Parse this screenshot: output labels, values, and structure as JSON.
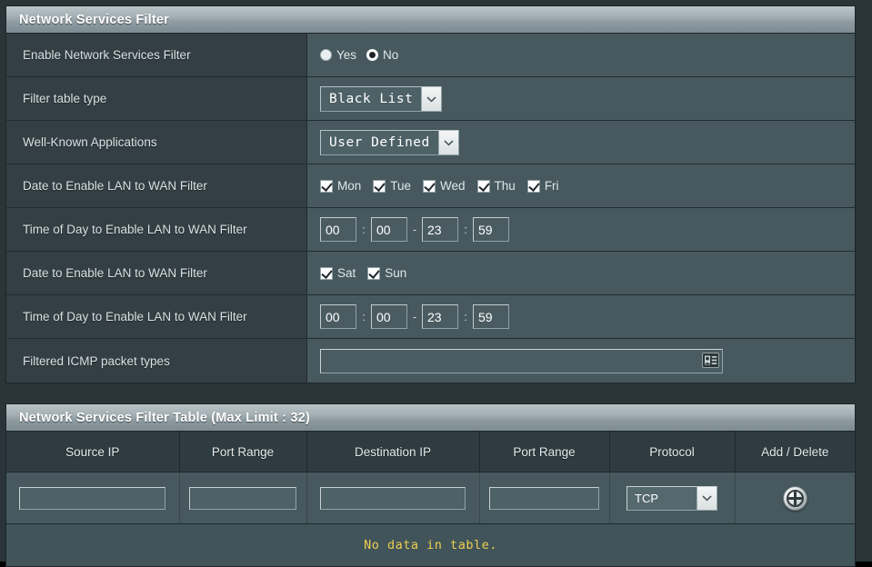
{
  "settings_panel": {
    "title": "Network Services Filter",
    "rows": {
      "enable": {
        "label": "Enable Network Services Filter",
        "options": [
          {
            "label": "Yes",
            "checked": false
          },
          {
            "label": "No",
            "checked": true
          }
        ]
      },
      "filter_table_type": {
        "label": "Filter table type",
        "value": "Black List"
      },
      "well_known_apps": {
        "label": "Well-Known Applications",
        "value": "User Defined"
      },
      "date_weekday": {
        "label": "Date to Enable LAN to WAN Filter",
        "days": [
          {
            "label": "Mon",
            "checked": true
          },
          {
            "label": "Tue",
            "checked": true
          },
          {
            "label": "Wed",
            "checked": true
          },
          {
            "label": "Thu",
            "checked": true
          },
          {
            "label": "Fri",
            "checked": true
          }
        ]
      },
      "time_weekday": {
        "label": "Time of Day to Enable LAN to WAN Filter",
        "start_hour": "00",
        "start_minute": "00",
        "end_hour": "23",
        "end_minute": "59",
        "colon": ":",
        "dash": "-"
      },
      "date_weekend": {
        "label": "Date to Enable LAN to WAN Filter",
        "days": [
          {
            "label": "Sat",
            "checked": true
          },
          {
            "label": "Sun",
            "checked": true
          }
        ]
      },
      "time_weekend": {
        "label": "Time of Day to Enable LAN to WAN Filter",
        "start_hour": "00",
        "start_minute": "00",
        "end_hour": "23",
        "end_minute": "59",
        "colon": ":",
        "dash": "-"
      },
      "icmp": {
        "label": "Filtered ICMP packet types",
        "value": "",
        "placeholder": "",
        "icon": "contact-card-icon"
      }
    }
  },
  "table_panel": {
    "title": "Network Services Filter Table (Max Limit : 32)",
    "columns": [
      "Source IP",
      "Port Range",
      "Destination IP",
      "Port Range",
      "Protocol",
      "Add / Delete"
    ],
    "entry_row": {
      "source_ip": "",
      "source_port_range": "",
      "destination_ip": "",
      "destination_port_range": "",
      "protocol": "TCP",
      "add_icon": "plus-circle-icon"
    },
    "empty_message": "No data in table."
  },
  "colors": {
    "page_background": "#2b3539",
    "panel_body": "#47595e",
    "label_column": "#333f44",
    "title_bar_light": "#b9c4c8",
    "title_bar_dark": "#7d8c92",
    "table_header": "#2e3b40",
    "empty_message_text": "#eecf4e",
    "text": "#ffffff"
  }
}
